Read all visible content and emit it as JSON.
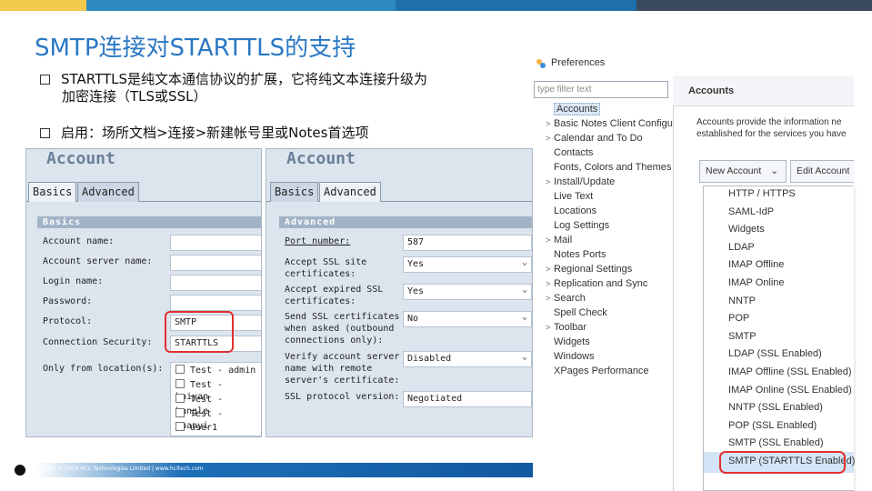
{
  "slide": {
    "title": "SMTP连接对STARTTLS的支持",
    "bullet1_line1": "STARTTLS是纯文本通信协议的扩展，它将纯文本连接升级为",
    "bullet1_line2": "加密连接（TLS或SSL）",
    "bullet2": "启用：场所文档>连接>新建帐号里或Notes首选项",
    "footer_text": "Copyright © 2016 HCL Technologies Limited  |  www.hcltech.com"
  },
  "account_basics": {
    "title": "Account",
    "tabs": [
      "Basics",
      "Advanced"
    ],
    "section": "Basics",
    "labels": [
      "Account name:",
      "Account server name:",
      "Login name:",
      "Password:",
      "Protocol:",
      "Connection Security:",
      "Only from location(s):"
    ],
    "protocol_value": "SMTP",
    "security_value": "STARTTLS",
    "locations": [
      "Test - admin",
      "Test - haiyan",
      "Test - hangle",
      "Test - yuanyi",
      "user1"
    ]
  },
  "account_advanced": {
    "title": "Account",
    "tabs": [
      "Basics",
      "Advanced"
    ],
    "section": "Advanced",
    "port_label": "Port number:",
    "port_value": "587",
    "accept_ssl_label": "Accept SSL site\ncertificates:",
    "accept_ssl_value": "Yes",
    "accept_expired_label": "Accept expired SSL\ncertificates:",
    "accept_expired_value": "Yes",
    "send_ssl_label": "Send SSL certificates\nwhen asked (outbound\nconnections only):",
    "send_ssl_value": "No",
    "verify_label": "Verify account server\nname with remote\nserver's certificate:",
    "verify_value": "Disabled",
    "ssl_version_label": "SSL protocol version:",
    "ssl_version_value": "Negotiated"
  },
  "preferences": {
    "window_title": "Preferences",
    "filter_placeholder": "type filter text",
    "nav": [
      {
        "label": "Accounts",
        "arrow": "",
        "selected": true
      },
      {
        "label": "Basic Notes Client Configu",
        "arrow": ">"
      },
      {
        "label": "Calendar and To Do",
        "arrow": ">"
      },
      {
        "label": "Contacts",
        "arrow": ""
      },
      {
        "label": "Fonts, Colors and Themes",
        "arrow": ""
      },
      {
        "label": "Install/Update",
        "arrow": ">"
      },
      {
        "label": "Live Text",
        "arrow": ""
      },
      {
        "label": "Locations",
        "arrow": ""
      },
      {
        "label": "Log Settings",
        "arrow": ""
      },
      {
        "label": "Mail",
        "arrow": ">"
      },
      {
        "label": "Notes Ports",
        "arrow": ""
      },
      {
        "label": "Regional Settings",
        "arrow": ">"
      },
      {
        "label": "Replication and Sync",
        "arrow": ">"
      },
      {
        "label": "Search",
        "arrow": ">"
      },
      {
        "label": "Spell Check",
        "arrow": ""
      },
      {
        "label": "Toolbar",
        "arrow": ">"
      },
      {
        "label": "Widgets",
        "arrow": ""
      },
      {
        "label": "Windows",
        "arrow": ""
      },
      {
        "label": "XPages Performance",
        "arrow": ""
      }
    ],
    "page_title": "Accounts",
    "description_line1": "Accounts provide the information ne",
    "description_line2": "established for the services you have",
    "new_account_label": "New Account",
    "edit_account_label": "Edit Account",
    "dropdown_items": [
      "HTTP / HTTPS",
      "SAML-IdP",
      "Widgets",
      "LDAP",
      "IMAP Offline",
      "IMAP Online",
      "NNTP",
      "POP",
      "SMTP",
      "LDAP (SSL Enabled)",
      "IMAP Offline (SSL Enabled)",
      "IMAP Online (SSL Enabled)",
      "NNTP (SSL Enabled)",
      "POP (SSL Enabled)",
      "SMTP (SSL Enabled)",
      "SMTP (STARTTLS Enabled)"
    ]
  }
}
